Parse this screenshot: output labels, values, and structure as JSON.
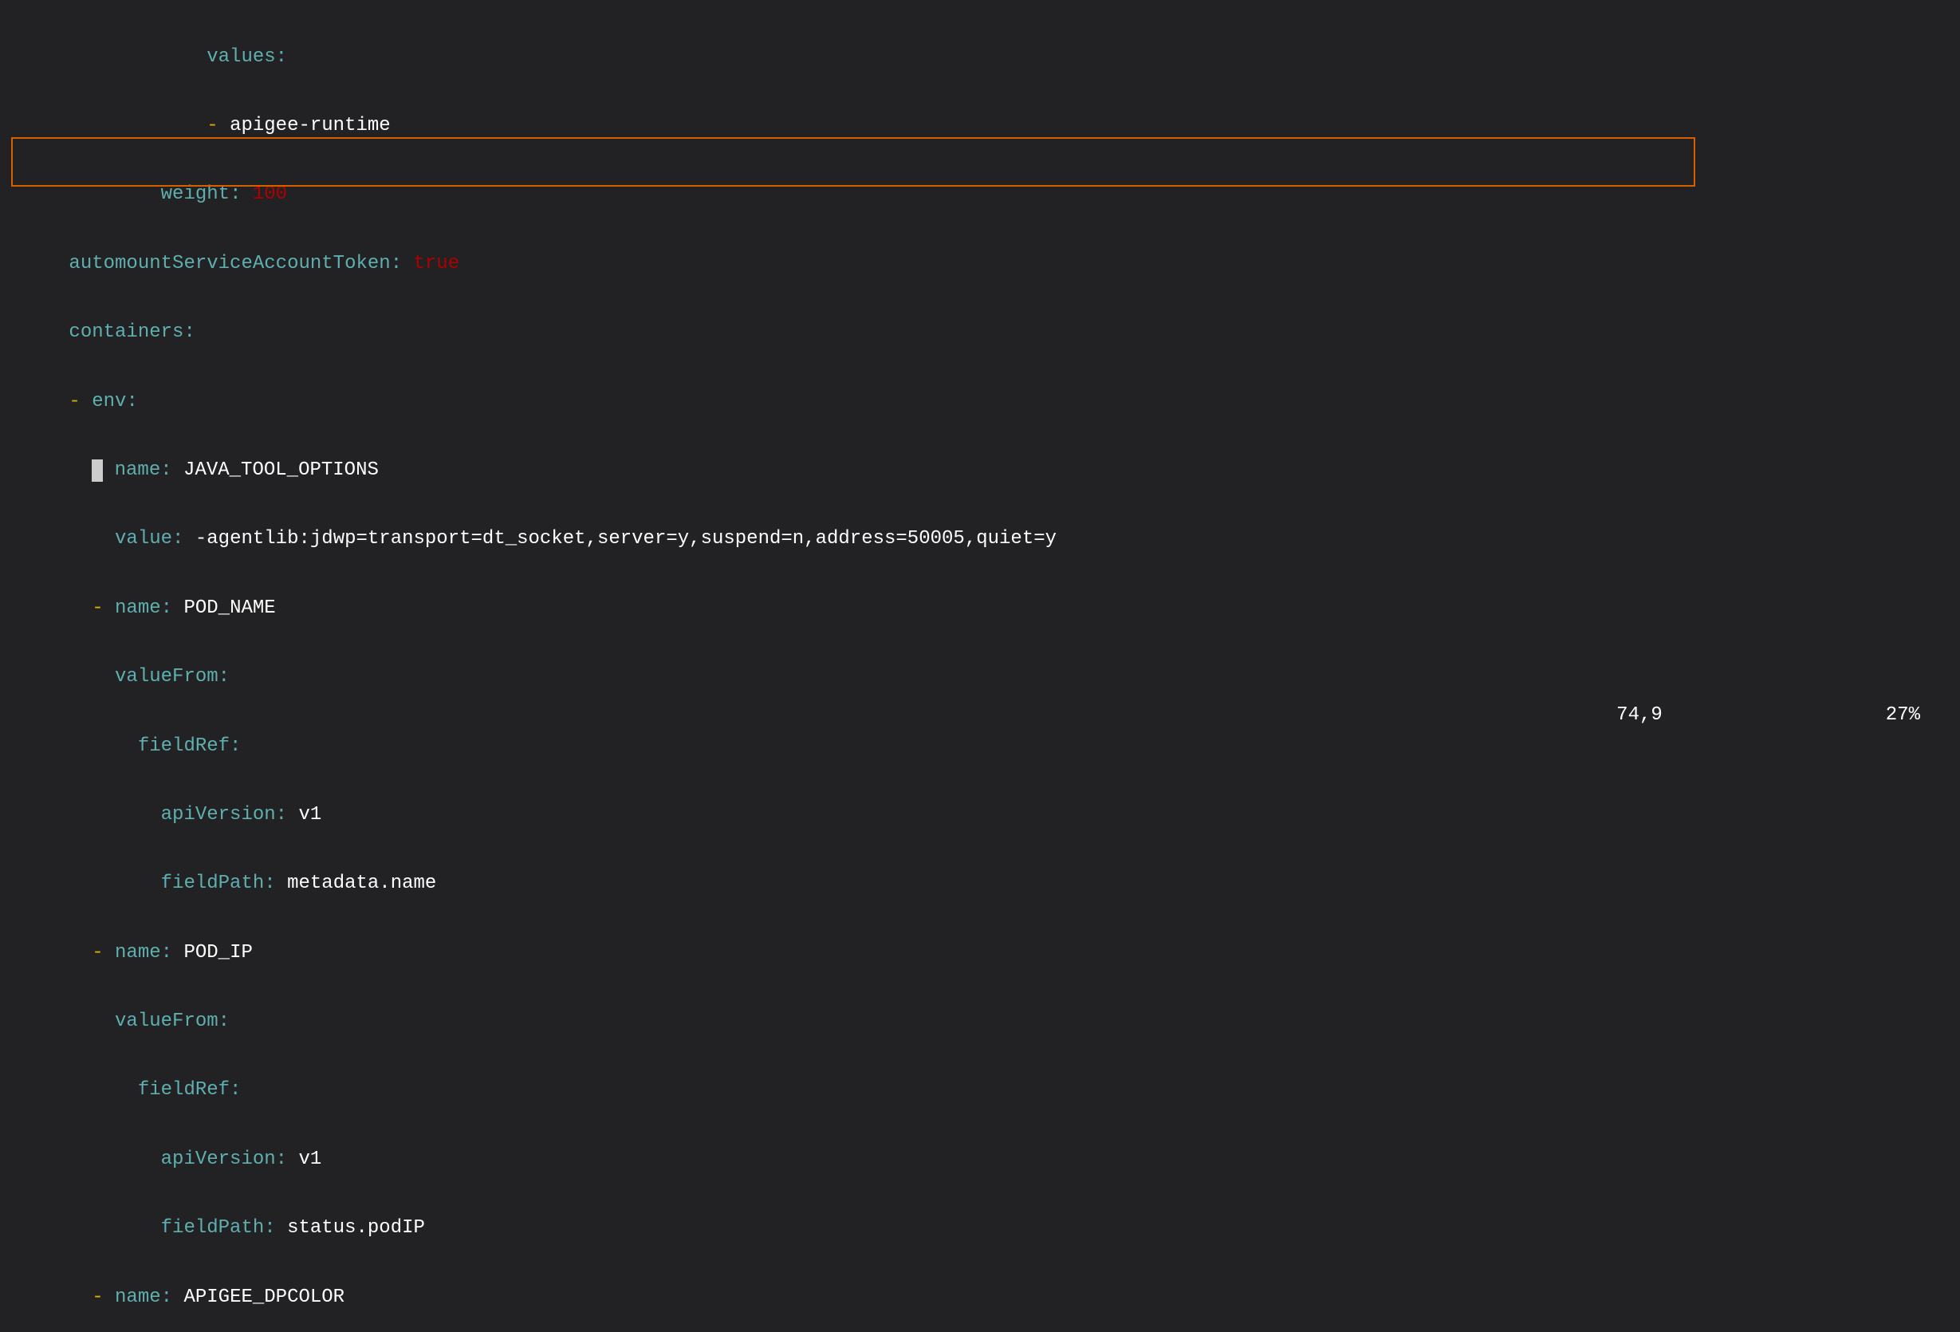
{
  "code": {
    "line1_key": "values",
    "line1_colon": ":",
    "line2_dash": "-",
    "line2_value": "apigee-runtime",
    "line3_key": "weight",
    "line3_colon": ":",
    "line3_value": "100",
    "line4_key": "automountServiceAccountToken",
    "line4_colon": ":",
    "line4_value": "true",
    "line5_key": "containers",
    "line5_colon": ":",
    "line6_dash": "-",
    "line6_key": "env",
    "line6_colon": ":",
    "line7_dash": "-",
    "line7_key": "name",
    "line7_colon": ":",
    "line7_value": "JAVA_TOOL_OPTIONS",
    "line8_key": "value",
    "line8_colon": ":",
    "line8_value": "-agentlib:jdwp=transport=dt_socket,server=y,suspend=n,address=50005,quiet=y",
    "line9_dash": "-",
    "line9_key": "name",
    "line9_colon": ":",
    "line9_value": "POD_NAME",
    "line10_key": "valueFrom",
    "line10_colon": ":",
    "line11_key": "fieldRef",
    "line11_colon": ":",
    "line12_key": "apiVersion",
    "line12_colon": ":",
    "line12_value": "v1",
    "line13_key": "fieldPath",
    "line13_colon": ":",
    "line13_value": "metadata.name",
    "line14_dash": "-",
    "line14_key": "name",
    "line14_colon": ":",
    "line14_value": "POD_IP",
    "line15_key": "valueFrom",
    "line15_colon": ":",
    "line16_key": "fieldRef",
    "line16_colon": ":",
    "line17_key": "apiVersion",
    "line17_colon": ":",
    "line17_value": "v1",
    "line18_key": "fieldPath",
    "line18_colon": ":",
    "line18_value": "status.podIP",
    "line19_dash": "-",
    "line19_key": "name",
    "line19_colon": ":",
    "line19_value": "APIGEE_DPCOLOR"
  },
  "status": {
    "position": "74,9",
    "percent": "27%"
  }
}
